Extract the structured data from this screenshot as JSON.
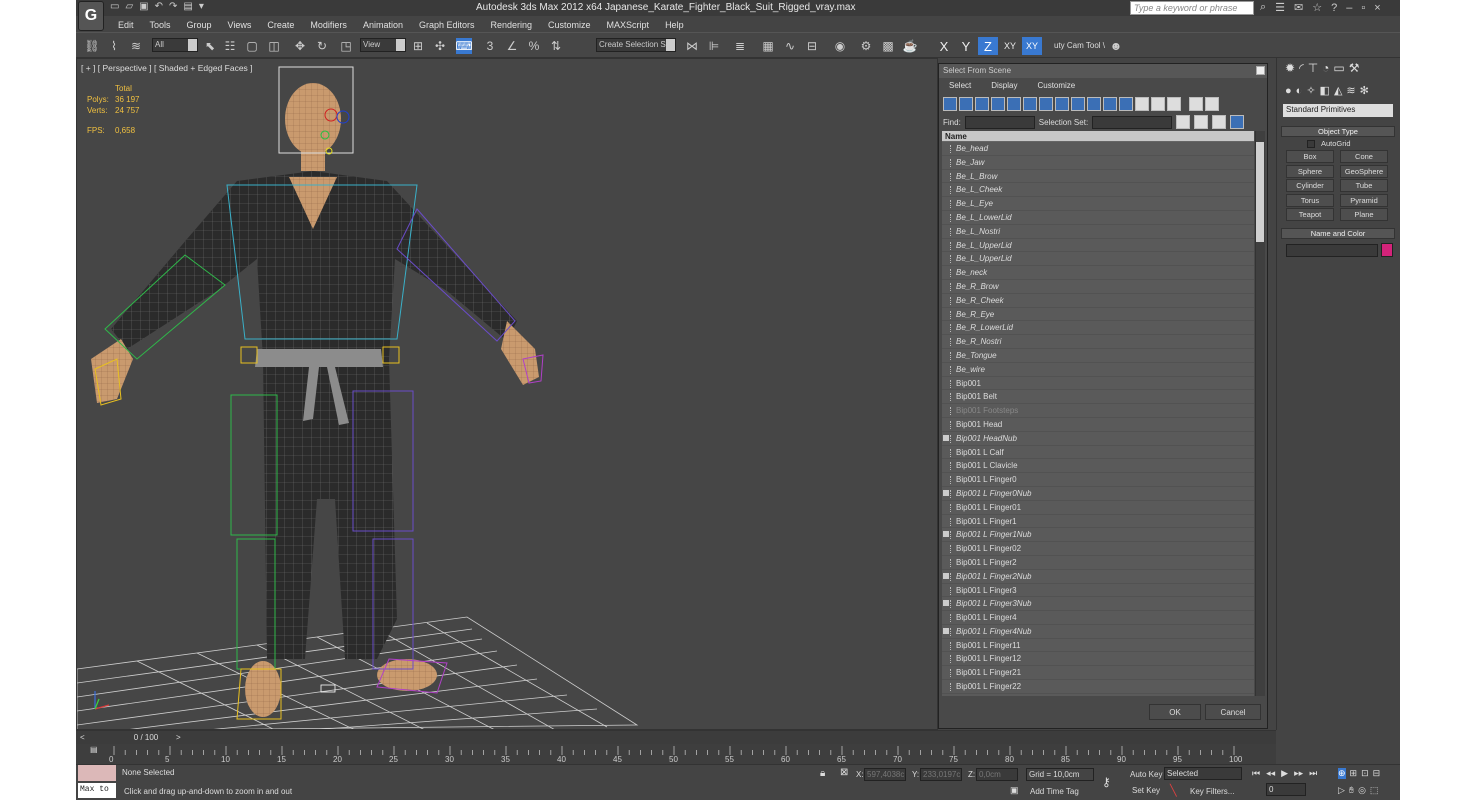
{
  "window": {
    "title": "Autodesk 3ds Max  2012 x64     Japanese_Karate_Fighter_Black_Suit_Rigged_vray.max",
    "search_placeholder": "Type a keyword or phrase",
    "logo": "G"
  },
  "menu": [
    "Edit",
    "Tools",
    "Group",
    "Views",
    "Create",
    "Modifiers",
    "Animation",
    "Graph Editors",
    "Rendering",
    "Customize",
    "MAXScript",
    "Help"
  ],
  "toolbar": {
    "filter": "All",
    "ref_coord": "View",
    "snap_3": "3",
    "selection_set": "Create Selection Se",
    "axes": [
      "X",
      "Y",
      "Z",
      "XY",
      "XY"
    ],
    "cam_tool": "uty Cam Tool \\"
  },
  "viewport": {
    "label": "[ + ] [ Perspective ] [ Shaded + Edged Faces ]",
    "stats_total": "Total",
    "polys_label": "Polys:",
    "polys_value": "36 197",
    "verts_label": "Verts:",
    "verts_value": "24 757",
    "fps_label": "FPS:",
    "fps_value": "0,658"
  },
  "select_dialog": {
    "title": "Select From Scene",
    "menus": [
      "Select",
      "Display",
      "Customize"
    ],
    "find_label": "Find:",
    "selset_label": "Selection Set:",
    "column_name": "Name",
    "items": [
      {
        "name": "Be_head",
        "style": "it"
      },
      {
        "name": "Be_Jaw",
        "style": "it"
      },
      {
        "name": "Be_L_Brow",
        "style": "it"
      },
      {
        "name": "Be_L_Cheek",
        "style": "it"
      },
      {
        "name": "Be_L_Eye",
        "style": "it"
      },
      {
        "name": "Be_L_LowerLid",
        "style": "it"
      },
      {
        "name": "Be_L_Nostri",
        "style": "it"
      },
      {
        "name": "Be_L_UpperLid",
        "style": "it"
      },
      {
        "name": "Be_L_UpperLid",
        "style": "it"
      },
      {
        "name": "Be_neck",
        "style": "it"
      },
      {
        "name": "Be_R_Brow",
        "style": "it"
      },
      {
        "name": "Be_R_Cheek",
        "style": "it"
      },
      {
        "name": "Be_R_Eye",
        "style": "it"
      },
      {
        "name": "Be_R_LowerLid",
        "style": "it"
      },
      {
        "name": "Be_R_Nostri",
        "style": "it"
      },
      {
        "name": "Be_Tongue",
        "style": "it"
      },
      {
        "name": "Be_wire",
        "style": "it"
      },
      {
        "name": "Bip001",
        "style": ""
      },
      {
        "name": "Bip001 Belt",
        "style": ""
      },
      {
        "name": "Bip001 Footsteps",
        "style": "dim"
      },
      {
        "name": "Bip001 Head",
        "style": ""
      },
      {
        "name": "Bip001 HeadNub",
        "style": "it nub"
      },
      {
        "name": "Bip001 L Calf",
        "style": ""
      },
      {
        "name": "Bip001 L Clavicle",
        "style": ""
      },
      {
        "name": "Bip001 L Finger0",
        "style": ""
      },
      {
        "name": "Bip001 L Finger0Nub",
        "style": "it nub"
      },
      {
        "name": "Bip001 L Finger01",
        "style": ""
      },
      {
        "name": "Bip001 L Finger1",
        "style": ""
      },
      {
        "name": "Bip001 L Finger1Nub",
        "style": "it nub"
      },
      {
        "name": "Bip001 L Finger02",
        "style": ""
      },
      {
        "name": "Bip001 L Finger2",
        "style": ""
      },
      {
        "name": "Bip001 L Finger2Nub",
        "style": "it nub"
      },
      {
        "name": "Bip001 L Finger3",
        "style": ""
      },
      {
        "name": "Bip001 L Finger3Nub",
        "style": "it nub"
      },
      {
        "name": "Bip001 L Finger4",
        "style": ""
      },
      {
        "name": "Bip001 L Finger4Nub",
        "style": "it nub"
      },
      {
        "name": "Bip001 L Finger11",
        "style": ""
      },
      {
        "name": "Bip001 L Finger12",
        "style": ""
      },
      {
        "name": "Bip001 L Finger21",
        "style": ""
      },
      {
        "name": "Bip001 L Finger22",
        "style": ""
      }
    ],
    "ok": "OK",
    "cancel": "Cancel"
  },
  "command_panel": {
    "dropdown": "Standard Primitives",
    "object_type": "Object Type",
    "autogrid": "AutoGrid",
    "buttons": [
      "Box",
      "Cone",
      "Sphere",
      "GeoSphere",
      "Cylinder",
      "Tube",
      "Torus",
      "Pyramid",
      "Teapot",
      "Plane"
    ],
    "name_and_color": "Name and Color",
    "swatch_color": "#d4237a"
  },
  "timeline": {
    "slider_label": "0 / 100",
    "ticks": [
      "0",
      "5",
      "10",
      "15",
      "20",
      "25",
      "30",
      "35",
      "40",
      "45",
      "50",
      "55",
      "60",
      "65",
      "70",
      "75",
      "80",
      "85",
      "90",
      "95",
      "100"
    ]
  },
  "status": {
    "maxscript_label": "Max to",
    "selection": "None Selected",
    "prompt": "Click and drag up-and-down to zoom in and out",
    "x_label": "X:",
    "x_value": "597,4038c",
    "y_label": "Y:",
    "y_value": "233,0197c",
    "z_label": "Z:",
    "z_value": "0,0cm",
    "grid": "Grid = 10,0cm",
    "add_time_tag": "Add Time Tag",
    "auto_key": "Auto Key",
    "set_key": "Set Key",
    "key_mode": "Selected",
    "key_filters": "Key Filters...",
    "frame": "0"
  }
}
